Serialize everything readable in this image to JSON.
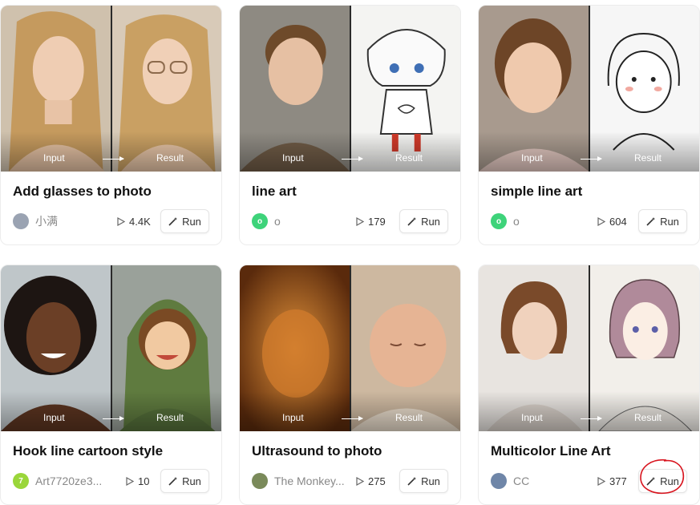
{
  "labels": {
    "input": "Input",
    "result": "Result",
    "run": "Run"
  },
  "cards": [
    {
      "title": "Add glasses to photo",
      "author": "小满",
      "plays": "4.4K",
      "avatar_color": "#9aa3b2",
      "avatar_letter": ""
    },
    {
      "title": "line art",
      "author": "o",
      "plays": "179",
      "avatar_color": "#3ed37a",
      "avatar_letter": "o"
    },
    {
      "title": "simple line art",
      "author": "o",
      "plays": "604",
      "avatar_color": "#3ed37a",
      "avatar_letter": "o"
    },
    {
      "title": "Hook line cartoon style",
      "author": "Art7720ze3...",
      "plays": "10",
      "avatar_color": "#9ad63a",
      "avatar_letter": "7"
    },
    {
      "title": "Ultrasound to photo",
      "author": "The Monkey...",
      "plays": "275",
      "avatar_color": "#7a8a5a",
      "avatar_letter": ""
    },
    {
      "title": "Multicolor Line Art",
      "author": "CC",
      "plays": "377",
      "avatar_color": "#6f86a8",
      "avatar_letter": ""
    }
  ],
  "annotation": {
    "color": "#d8141e"
  }
}
